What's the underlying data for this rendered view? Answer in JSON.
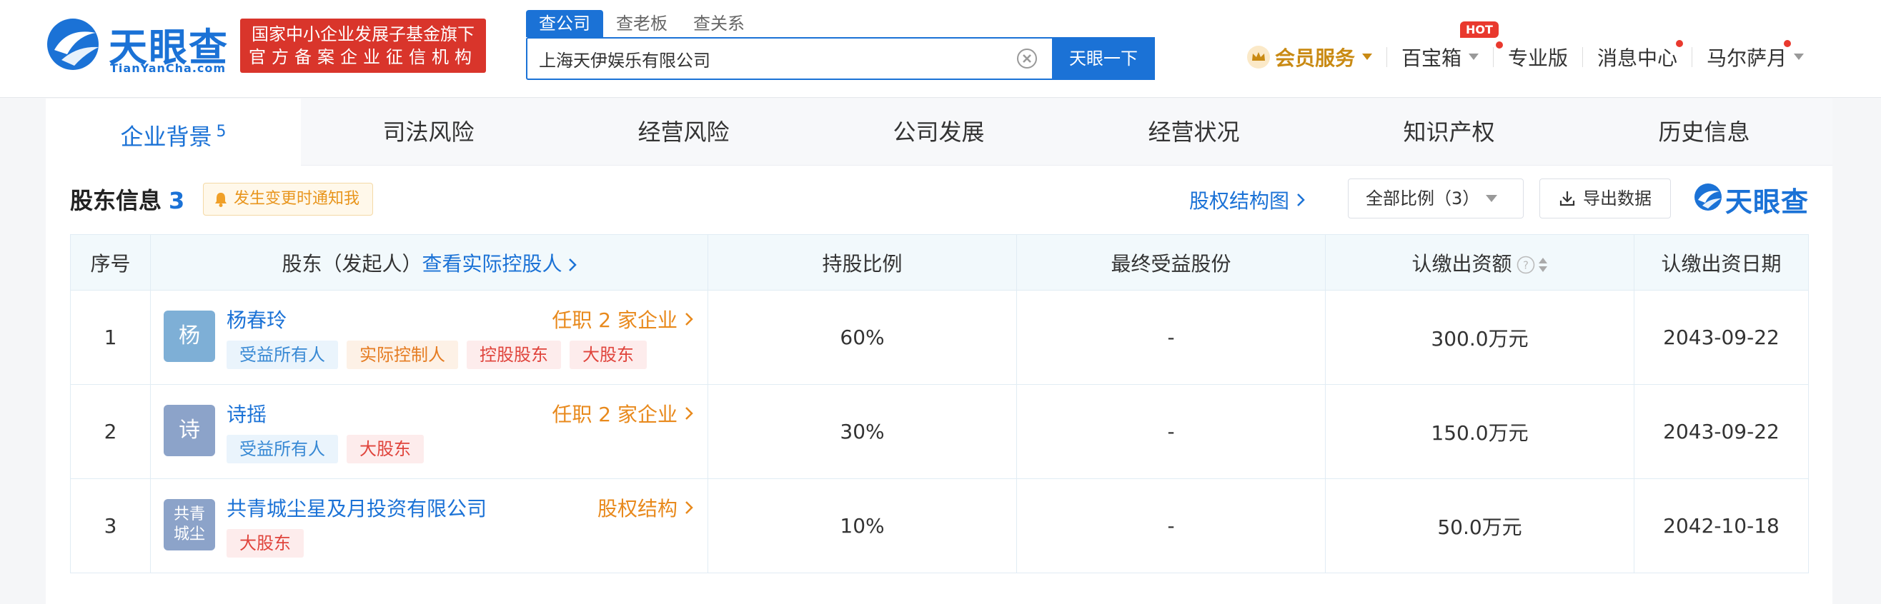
{
  "brand": {
    "name": "天眼查",
    "domain": "TianYanCha.com",
    "fund_line1": "国家中小企业发展子基金旗下",
    "fund_line2": "官方备案企业征信机构"
  },
  "search": {
    "tabs": [
      "查公司",
      "查老板",
      "查关系"
    ],
    "value": "上海天伊娱乐有限公司",
    "button": "天眼一下"
  },
  "nav": {
    "vip": "会员服务",
    "treasure": "百宝箱",
    "hot": "HOT",
    "pro": "专业版",
    "messages": "消息中心",
    "user": "马尔萨月"
  },
  "tabs": [
    {
      "label": "企业背景",
      "count": "5"
    },
    {
      "label": "司法风险"
    },
    {
      "label": "经营风险"
    },
    {
      "label": "公司发展"
    },
    {
      "label": "经营状况"
    },
    {
      "label": "知识产权"
    },
    {
      "label": "历史信息"
    }
  ],
  "section": {
    "title": "股东信息",
    "count": "3",
    "notify": "发生变更时通知我",
    "equity_link": "股权结构图",
    "ratio_select": "全部比例（3）",
    "export": "导出数据",
    "watermark": "天眼查"
  },
  "table": {
    "headers": {
      "index": "序号",
      "holder": "股东（发起人）",
      "holder_link": "查看实际控股人",
      "ratio": "持股比例",
      "final_share": "最终受益股份",
      "amount": "认缴出资额",
      "date": "认缴出资日期"
    },
    "rows": [
      {
        "index": "1",
        "avatar": "杨",
        "avatar_color": "#7eafd6",
        "name": "杨春玲",
        "link": "任职 2 家企业",
        "tags": [
          {
            "text": "受益所有人",
            "style": "blue"
          },
          {
            "text": "实际控制人",
            "style": "orange"
          },
          {
            "text": "控股股东",
            "style": "red"
          },
          {
            "text": "大股东",
            "style": "red"
          }
        ],
        "ratio": "60%",
        "final_share": "-",
        "amount": "300.0万元",
        "date": "2043-09-22"
      },
      {
        "index": "2",
        "avatar": "诗",
        "avatar_color": "#8ca3c9",
        "name": "诗摇",
        "link": "任职 2 家企业",
        "tags": [
          {
            "text": "受益所有人",
            "style": "blue"
          },
          {
            "text": "大股东",
            "style": "red"
          }
        ],
        "ratio": "30%",
        "final_share": "-",
        "amount": "150.0万元",
        "date": "2043-09-22"
      },
      {
        "index": "3",
        "avatar_line1": "共青",
        "avatar_line2": "城尘",
        "avatar_color": "#8ca3c9",
        "name": "共青城尘星及月投资有限公司",
        "link": "股权结构",
        "tags": [
          {
            "text": "大股东",
            "style": "red"
          }
        ],
        "ratio": "10%",
        "final_share": "-",
        "amount": "50.0万元",
        "date": "2042-10-18"
      }
    ]
  },
  "colors": {
    "primary": "#1b72d6",
    "vip_gold": "#c98a13",
    "badge_red": "#d9352b",
    "link_orange": "#e8891c"
  }
}
